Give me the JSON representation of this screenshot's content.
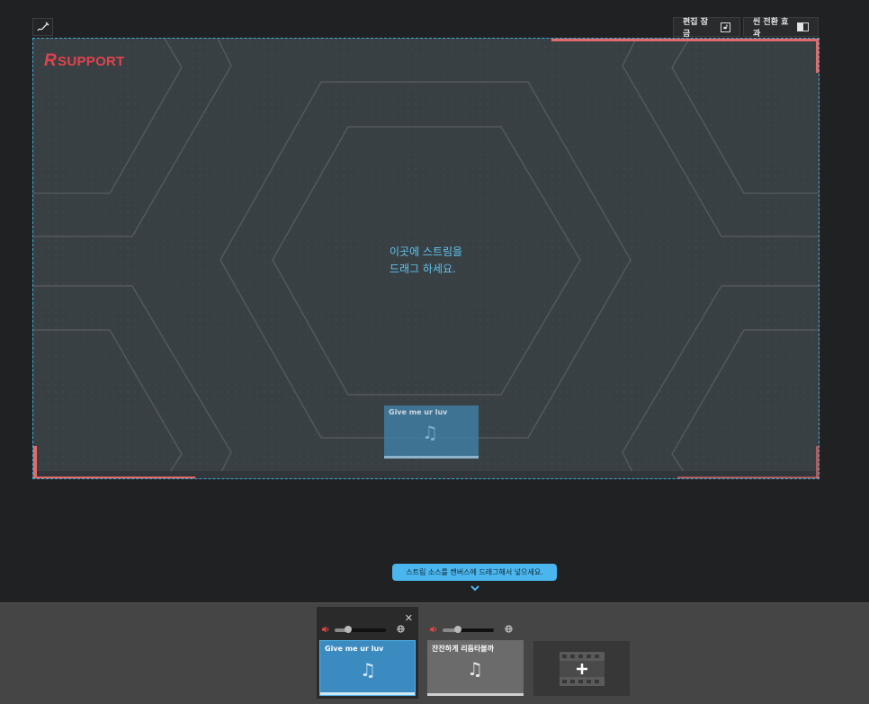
{
  "toolbar": {
    "pen_icon": "pen-icon",
    "edit_lock_label": "편집 잠금",
    "lock_icon": "lock-icon",
    "scene_transition_label": "씬 전환 효과",
    "toggle_icon": "toggle-icon"
  },
  "canvas": {
    "logo_text": "SUPPORT",
    "logo_r": "R",
    "drop_text_line1": "이곳에 스트림을",
    "drop_text_line2": "드래그 하세요.",
    "placed_item_title": "Give me ur luv",
    "music_icon": "♫"
  },
  "hint": {
    "text": "스트림 소스를 캔버스에 드래그해서 넣으세요.",
    "chevron": "⌄"
  },
  "sources": [
    {
      "title": "Give me ur luv",
      "volume": 0.25,
      "selected": true,
      "has_close": true,
      "close_glyph": "✕"
    },
    {
      "title": "잔잔하게 리듬타볼까",
      "volume": 0.3,
      "selected": false,
      "has_close": false
    }
  ],
  "add_source": {
    "icon": "film-add-icon",
    "plus": "+"
  },
  "colors": {
    "accent_blue": "#4bb6ee",
    "canvas_bg": "#394044",
    "frame_red": "#e36a6a",
    "logo_red": "#e0434d"
  }
}
